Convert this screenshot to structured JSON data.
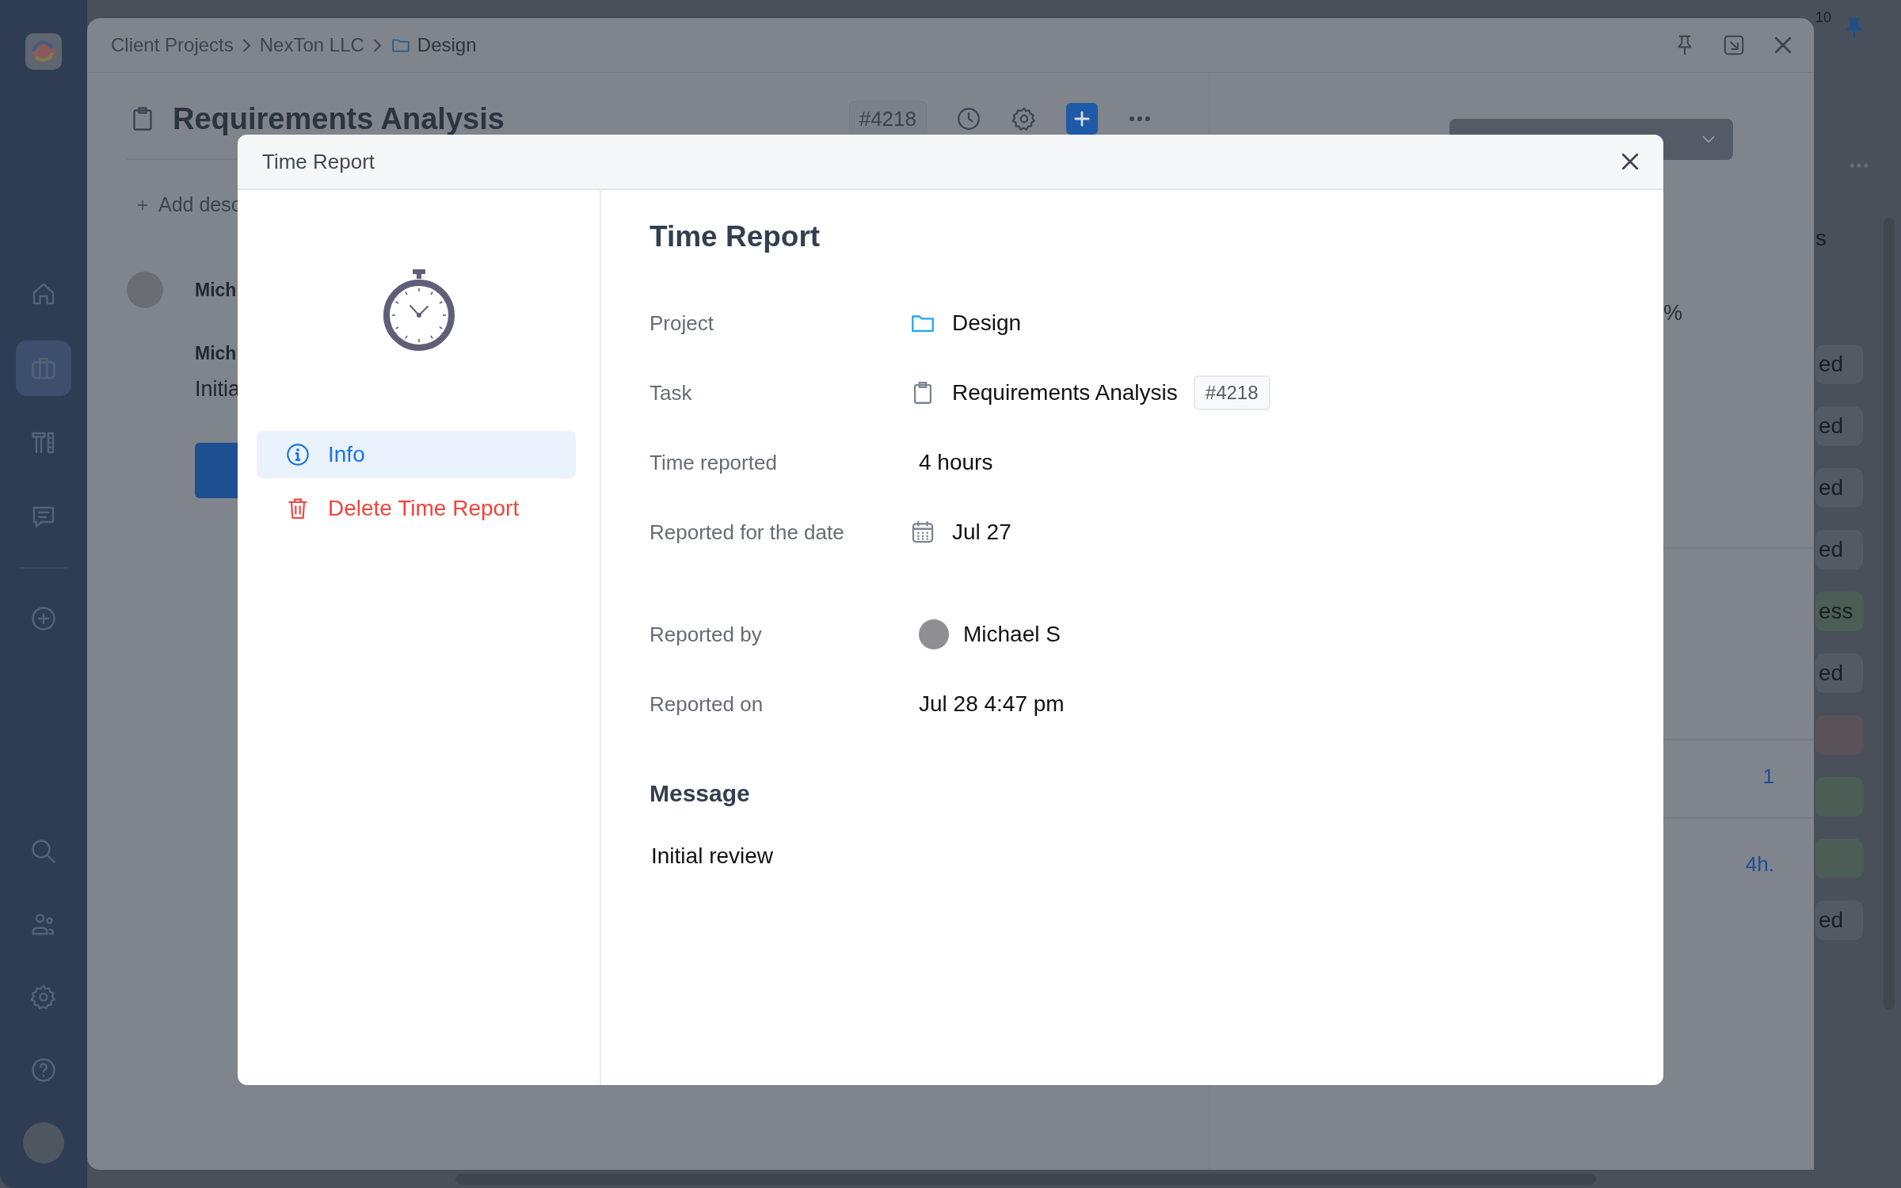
{
  "app_rail": {
    "items": [
      {
        "kind": "home",
        "selected": false
      },
      {
        "kind": "briefcase",
        "selected": true
      },
      {
        "kind": "tools",
        "selected": false
      },
      {
        "kind": "chat",
        "selected": false
      },
      {
        "kind": "add",
        "selected": false
      }
    ],
    "bottom_items": [
      {
        "kind": "search",
        "selected": false
      },
      {
        "kind": "people",
        "selected": false
      },
      {
        "kind": "settings",
        "selected": false
      },
      {
        "kind": "help",
        "selected": false
      },
      {
        "kind": "avatar",
        "selected": false
      }
    ]
  },
  "notifications": {
    "count": "10"
  },
  "window": {
    "breadcrumb": [
      {
        "label": "Client Projects",
        "kind": "text"
      },
      {
        "label": "NexTon LLC",
        "kind": "text"
      },
      {
        "label": "Design",
        "kind": "folder"
      }
    ],
    "task": {
      "title": "Requirements Analysis",
      "number": "#4218"
    },
    "add_description": "Add desc",
    "activity": [
      {
        "kind": "header",
        "author": "Mich"
      },
      {
        "kind": "message",
        "author": "Mich",
        "text": "Initia"
      }
    ],
    "side_panel": {
      "percent_fragment": "%",
      "counts": [
        "1",
        "4h."
      ]
    }
  },
  "background_panel": {
    "heading_fragment": "s",
    "tags": [
      {
        "label": "ed",
        "color": "#535a64"
      },
      {
        "label": "ed",
        "color": "#535a64"
      },
      {
        "label": "ed",
        "color": "#535a64"
      },
      {
        "label": "ed",
        "color": "#535a64"
      },
      {
        "label": "ess",
        "color": "#4c5d55"
      },
      {
        "label": "ed",
        "color": "#535a64"
      },
      {
        "color": "#5a5259"
      },
      {
        "color": "#4c5d55"
      },
      {
        "color": "#4c5d55"
      },
      {
        "label": "ed",
        "color": "#535a64"
      }
    ]
  },
  "modal": {
    "title": "Time Report",
    "menu": [
      {
        "kind": "info",
        "label": "Info",
        "selected": true
      },
      {
        "kind": "delete",
        "label": "Delete Time Report",
        "selected": false
      }
    ],
    "heading": "Time Report",
    "details": [
      {
        "label": "Project",
        "kind": "folder",
        "value": "Design"
      },
      {
        "label": "Task",
        "kind": "task",
        "value": "Requirements Analysis",
        "badge": "#4218"
      },
      {
        "label": "Time reported",
        "kind": "text",
        "value": "4 hours"
      },
      {
        "label": "Reported for the date",
        "kind": "date",
        "value": "Jul 27"
      }
    ],
    "meta": [
      {
        "label": "Reported by",
        "kind": "person",
        "value": "Michael S"
      },
      {
        "label": "Reported on",
        "kind": "text",
        "value": "Jul 28 4:47 pm"
      }
    ],
    "message": {
      "heading": "Message",
      "text": "Initial review"
    }
  }
}
